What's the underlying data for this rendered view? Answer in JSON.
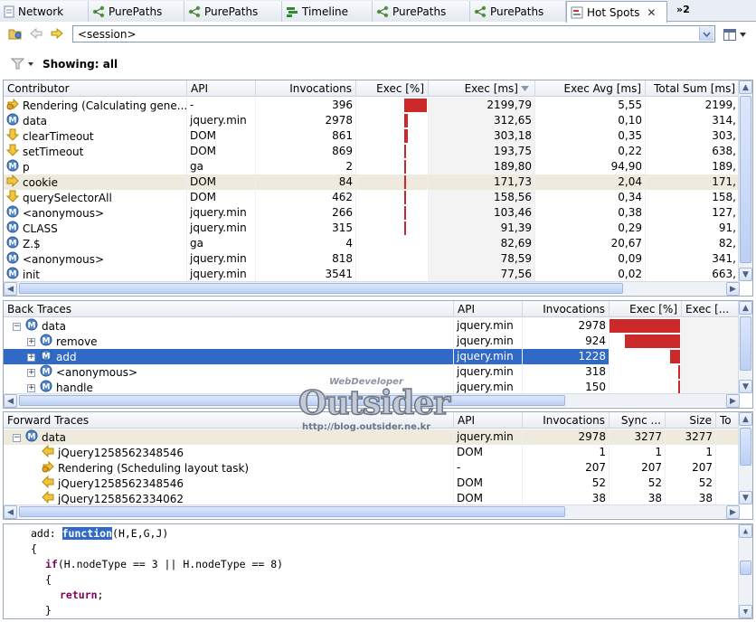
{
  "tabs": [
    {
      "label": "Network",
      "icon": "page-icon"
    },
    {
      "label": "PurePaths",
      "icon": "purepaths-icon"
    },
    {
      "label": "PurePaths",
      "icon": "purepaths-icon"
    },
    {
      "label": "Timeline",
      "icon": "timeline-icon"
    },
    {
      "label": "PurePaths",
      "icon": "purepaths-icon"
    },
    {
      "label": "PurePaths",
      "icon": "purepaths-icon"
    },
    {
      "label": "Hot Spots",
      "icon": "hotspots-icon",
      "active": true
    }
  ],
  "tab_overflow": "»2",
  "session": {
    "value": "<session>"
  },
  "filter": {
    "showing": "Showing: all"
  },
  "contributors": {
    "columns": [
      "Contributor",
      "API",
      "Invocations",
      "Exec [%]",
      "Exec [ms]",
      "Exec Avg [ms]",
      "Total Sum [ms]"
    ],
    "rows": [
      {
        "icon": "rendering-icon",
        "name": "Rendering (Calculating gene...",
        "api": "-",
        "inv": "396",
        "pct": 1.0,
        "ms": "2199,79",
        "avg": "5,55",
        "total": "2199,"
      },
      {
        "icon": "method-icon",
        "name": "data",
        "api": "jquery.min",
        "inv": "2978",
        "pct": 0.14,
        "ms": "312,65",
        "avg": "0,10",
        "total": "314,"
      },
      {
        "icon": "arrow-down-icon",
        "name": "clearTimeout",
        "api": "DOM",
        "inv": "861",
        "pct": 0.14,
        "ms": "303,18",
        "avg": "0,35",
        "total": "303,"
      },
      {
        "icon": "arrow-down-icon",
        "name": "setTimeout",
        "api": "DOM",
        "inv": "869",
        "pct": 0.09,
        "ms": "193,75",
        "avg": "0,22",
        "total": "638,"
      },
      {
        "icon": "method-icon",
        "name": "p",
        "api": "ga",
        "inv": "2",
        "pct": 0.09,
        "ms": "189,80",
        "avg": "94,90",
        "total": "189,"
      },
      {
        "icon": "arrow-right-icon",
        "name": "cookie",
        "api": "DOM",
        "inv": "84",
        "pct": 0.08,
        "ms": "171,73",
        "avg": "2,04",
        "total": "171,",
        "highlight": true
      },
      {
        "icon": "arrow-down-icon",
        "name": "querySelectorAll",
        "api": "DOM",
        "inv": "462",
        "pct": 0.07,
        "ms": "158,56",
        "avg": "0,34",
        "total": "158,"
      },
      {
        "icon": "method-icon",
        "name": "<anonymous>",
        "api": "jquery.min",
        "inv": "266",
        "pct": 0.05,
        "ms": "103,46",
        "avg": "0,38",
        "total": "127,"
      },
      {
        "icon": "method-icon",
        "name": "CLASS",
        "api": "jquery.min",
        "inv": "315",
        "pct": 0.04,
        "ms": "91,39",
        "avg": "0,29",
        "total": "91,"
      },
      {
        "icon": "method-icon",
        "name": "Z.$",
        "api": "ga",
        "inv": "4",
        "pct": 0.0,
        "ms": "82,69",
        "avg": "20,67",
        "total": "82,"
      },
      {
        "icon": "method-icon",
        "name": "<anonymous>",
        "api": "jquery.min",
        "inv": "818",
        "pct": 0.0,
        "ms": "78,59",
        "avg": "0,09",
        "total": "341,"
      },
      {
        "icon": "method-icon",
        "name": "init",
        "api": "jquery.min",
        "inv": "3541",
        "pct": 0.0,
        "ms": "77,56",
        "avg": "0,02",
        "total": "663,"
      }
    ]
  },
  "backtraces": {
    "columns": [
      "Back Traces",
      "API",
      "Invocations",
      "Exec [%]",
      "Exec [..."
    ],
    "rows": [
      {
        "level": 0,
        "expander": "−",
        "name": "data",
        "api": "jquery.min",
        "inv": "2978",
        "pct": 1.0
      },
      {
        "level": 1,
        "expander": "+",
        "name": "remove",
        "api": "jquery.min",
        "inv": "924",
        "pct": 0.78
      },
      {
        "level": 1,
        "expander": "+",
        "name": "add",
        "api": "jquery.min",
        "inv": "1228",
        "pct": 0.14,
        "selected": true
      },
      {
        "level": 1,
        "expander": "+",
        "name": "<anonymous>",
        "api": "jquery.min",
        "inv": "318",
        "pct": 0.03
      },
      {
        "level": 1,
        "expander": "+",
        "name": "handle",
        "api": "jquery.min",
        "inv": "150",
        "pct": 0.02
      }
    ]
  },
  "forwardtraces": {
    "columns": [
      "Forward Traces",
      "API",
      "Invocations",
      "Sync ...",
      "Size",
      "To"
    ],
    "rows": [
      {
        "level": 0,
        "expander": "−",
        "icon": "method-icon",
        "name": "data",
        "api": "jquery.min",
        "inv": "2978",
        "sync": "3277",
        "size": "3277",
        "highlight": true
      },
      {
        "level": 1,
        "icon": "arrow-left-icon",
        "name": "jQuery1258562348546",
        "api": "DOM",
        "inv": "1",
        "sync": "1",
        "size": "1"
      },
      {
        "level": 1,
        "icon": "rendering-icon",
        "name": "Rendering (Scheduling layout task)",
        "api": "-",
        "inv": "207",
        "sync": "207",
        "size": "207"
      },
      {
        "level": 1,
        "icon": "arrow-left-icon",
        "name": "jQuery1258562348546",
        "api": "DOM",
        "inv": "52",
        "sync": "52",
        "size": "52"
      },
      {
        "level": 1,
        "icon": "arrow-left-icon",
        "name": "jQuery1258562334062",
        "api": "DOM",
        "inv": "38",
        "sync": "38",
        "size": "38"
      }
    ]
  },
  "code": {
    "line1_prefix": "add: ",
    "line1_fn": "function",
    "line1_rest": "(H,E,G,J)",
    "line2": "{",
    "line3_kw": "if",
    "line3_rest": "(H.nodeType == 3 || H.nodeType == 8)",
    "line4": "{",
    "line5_kw": "return",
    "line5_rest": ";",
    "line6": "}"
  },
  "watermark": {
    "top": "WebDeveloper",
    "main": "Outsider",
    "url": "http://blog.outsider.ne.kr"
  },
  "colors": {
    "bar": "#cc2a2a",
    "selection": "#3169c6",
    "highlight": "#eeeadd"
  }
}
